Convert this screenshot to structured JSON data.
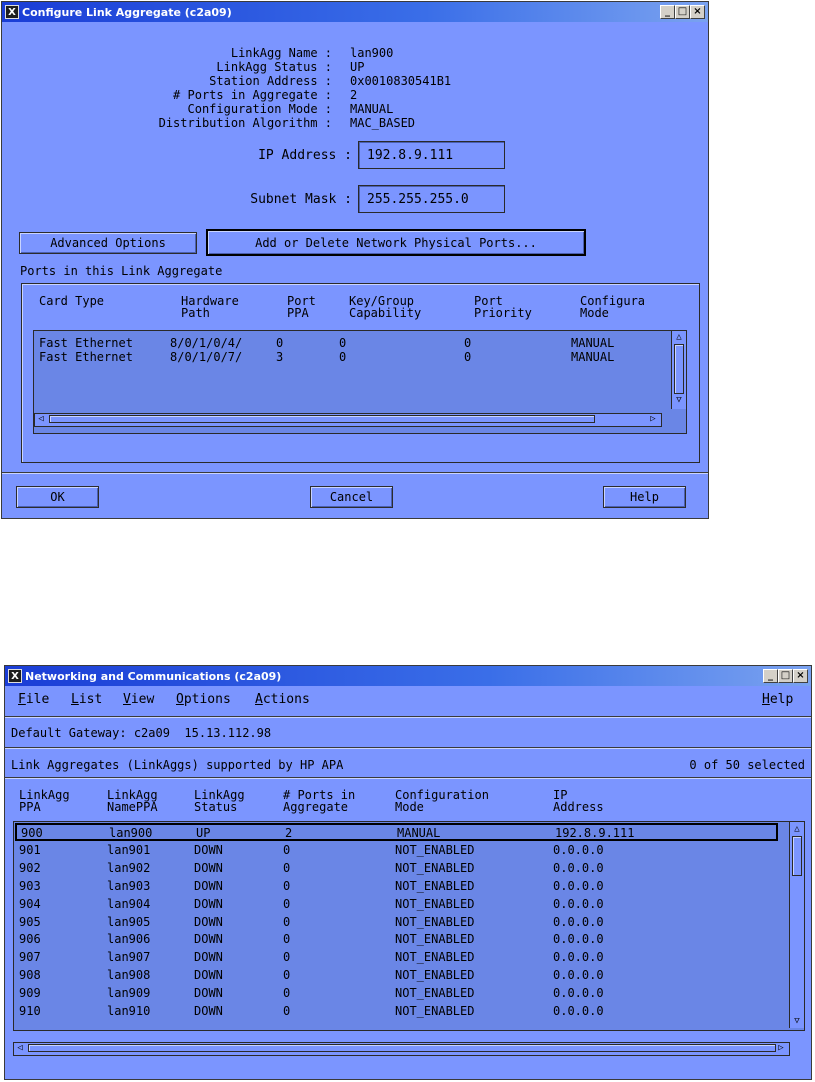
{
  "dialog": {
    "title": "Configure Link Aggregate (c2a09)",
    "win_buttons": [
      "_",
      "□",
      "×"
    ],
    "info": [
      {
        "label": "LinkAgg Name",
        "value": "lan900"
      },
      {
        "label": "LinkAgg Status",
        "value": "UP"
      },
      {
        "label": "Station Address",
        "value": "0x0010830541B1"
      },
      {
        "label": "# Ports in Aggregate",
        "value": "2"
      },
      {
        "label": "Configuration Mode",
        "value": "MANUAL"
      },
      {
        "label": "Distribution Algorithm",
        "value": "MAC_BASED"
      }
    ],
    "ip_label": "IP Address :",
    "ip_value": "192.8.9.111",
    "subnet_label": "Subnet Mask :",
    "subnet_value": "255.255.255.0",
    "advanced_button": "Advanced Options",
    "ports_button": "Add or Delete Network Physical Ports...",
    "ports_section_label": "Ports in this Link Aggregate",
    "ports_columns": [
      "Card Type",
      "Hardware\nPath",
      "Port\nPPA",
      "Key/Group\nCapability",
      "Port\nPriority",
      "Configura\nMode"
    ],
    "ports_rows": [
      [
        "Fast Ethernet",
        "8/0/1/0/4/",
        "0",
        "0",
        "0",
        "MANUAL"
      ],
      [
        "Fast Ethernet",
        "8/0/1/0/7/",
        "3",
        "0",
        "0",
        "MANUAL"
      ]
    ],
    "ok_button": "OK",
    "cancel_button": "Cancel",
    "help_button": "Help"
  },
  "main": {
    "title": "Networking and Communications (c2a09)",
    "win_buttons": [
      "_",
      "□",
      "×"
    ],
    "menu": [
      {
        "pre": "",
        "ul": "F",
        "post": "ile"
      },
      {
        "pre": "",
        "ul": "L",
        "post": "ist"
      },
      {
        "pre": "",
        "ul": "V",
        "post": "iew"
      },
      {
        "pre": "",
        "ul": "O",
        "post": "ptions"
      },
      {
        "pre": "",
        "ul": "A",
        "post": "ctions"
      }
    ],
    "help_menu": {
      "pre": "",
      "ul": "H",
      "post": "elp"
    },
    "gateway_text": "Default Gateway: c2a09  15.13.112.98",
    "list_title": "Link Aggregates (LinkAggs) supported by HP APA",
    "selection_count": "0 of 50 selected",
    "columns": [
      "LinkAgg\nPPA",
      "LinkAgg\nNamePPA",
      "LinkAgg\nStatus",
      "# Ports in\nAggregate",
      "Configuration\nMode",
      "IP\nAddress"
    ],
    "rows": [
      [
        "900",
        "lan900",
        "UP",
        "2",
        "MANUAL",
        "192.8.9.111"
      ],
      [
        "901",
        "lan901",
        "DOWN",
        "0",
        "NOT_ENABLED",
        "0.0.0.0"
      ],
      [
        "902",
        "lan902",
        "DOWN",
        "0",
        "NOT_ENABLED",
        "0.0.0.0"
      ],
      [
        "903",
        "lan903",
        "DOWN",
        "0",
        "NOT_ENABLED",
        "0.0.0.0"
      ],
      [
        "904",
        "lan904",
        "DOWN",
        "0",
        "NOT_ENABLED",
        "0.0.0.0"
      ],
      [
        "905",
        "lan905",
        "DOWN",
        "0",
        "NOT_ENABLED",
        "0.0.0.0"
      ],
      [
        "906",
        "lan906",
        "DOWN",
        "0",
        "NOT_ENABLED",
        "0.0.0.0"
      ],
      [
        "907",
        "lan907",
        "DOWN",
        "0",
        "NOT_ENABLED",
        "0.0.0.0"
      ],
      [
        "908",
        "lan908",
        "DOWN",
        "0",
        "NOT_ENABLED",
        "0.0.0.0"
      ],
      [
        "909",
        "lan909",
        "DOWN",
        "0",
        "NOT_ENABLED",
        "0.0.0.0"
      ],
      [
        "910",
        "lan910",
        "DOWN",
        "0",
        "NOT_ENABLED",
        "0.0.0.0"
      ]
    ]
  },
  "colors": {
    "window_bg": "#7b95ff",
    "list_bg": "#6a86e6",
    "titlebar": "#1a3dd6"
  }
}
